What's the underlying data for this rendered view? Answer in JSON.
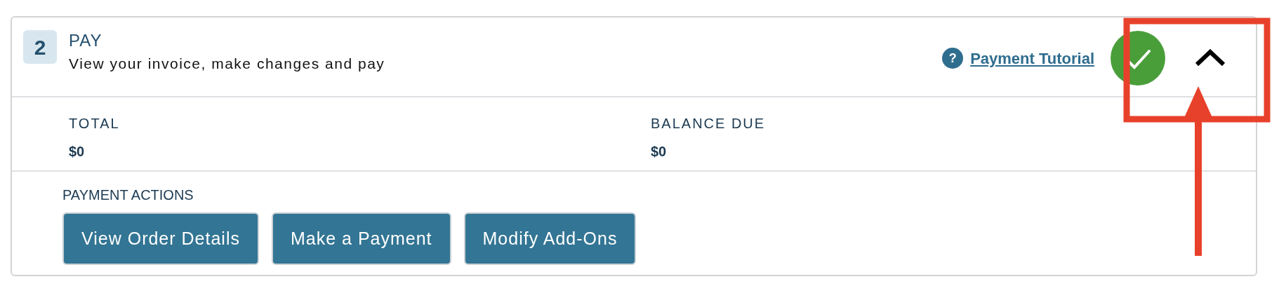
{
  "step": {
    "number": "2",
    "title": "PAY",
    "subtitle": "View your invoice, make changes and pay",
    "completed": true,
    "expanded": true
  },
  "help_link": {
    "icon_text": "?",
    "label": "Payment Tutorial"
  },
  "summary": [
    {
      "label": "TOTAL",
      "value": "$0"
    },
    {
      "label": "BALANCE DUE",
      "value": "$0"
    }
  ],
  "actions": {
    "heading": "PAYMENT ACTIONS",
    "buttons": [
      "View Order Details",
      "Make a Payment",
      "Modify Add-Ons"
    ]
  },
  "annotation": {
    "kind": "highlight-arrow",
    "color": "#e8412b"
  }
}
